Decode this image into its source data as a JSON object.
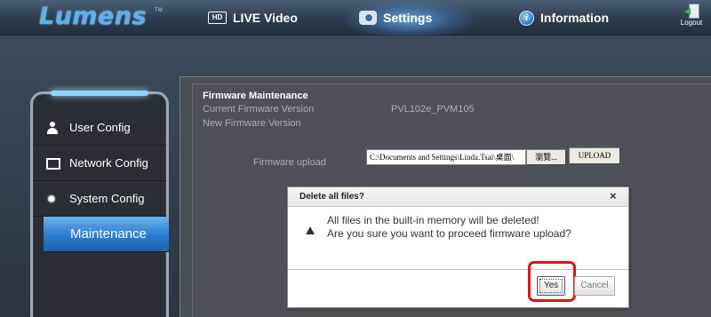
{
  "brand": {
    "logo": "Lumens",
    "tm": "TM"
  },
  "nav": {
    "live": {
      "icon_text": "HD",
      "label": "LIVE Video"
    },
    "settings": {
      "label": "Settings"
    },
    "info": {
      "label": "Information"
    },
    "logout": {
      "label": "Logout"
    }
  },
  "sidebar": {
    "items": [
      {
        "label": "User Config",
        "icon": "user-icon"
      },
      {
        "label": "Network Config",
        "icon": "monitor-icon"
      },
      {
        "label": "System Config",
        "icon": "gear-icon",
        "glyph": "✹"
      },
      {
        "label": "Maintenance",
        "active": true
      }
    ]
  },
  "firmware": {
    "title": "Firmware Maintenance",
    "current_label": "Current Firmware Version",
    "current_value": "PVL102e_PVM105",
    "new_label": "New Firmware Version",
    "upload_label": "Firmware upload",
    "file_path": "C:\\Documents and Settings\\Linda.Tsai\\桌面\\",
    "browse_label": "瀏覽...",
    "upload_button": "UPLOAD"
  },
  "dialog": {
    "title": "Delete all files?",
    "close": "×",
    "message_line1": "All files in the built-in memory will be deleted!",
    "message_line2": "Are you sure you want to proceed firmware upload?",
    "yes": "Yes",
    "cancel": "Cancel"
  },
  "colors": {
    "accent": "#2a7cd0",
    "highlight": "#e01313"
  }
}
